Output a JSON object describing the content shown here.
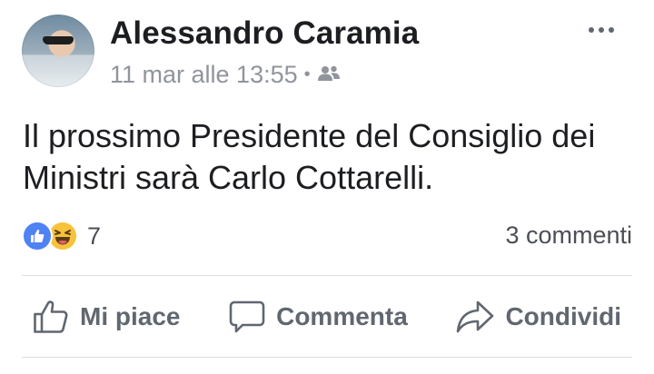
{
  "post": {
    "author": "Alessandro Caramia",
    "timestamp": "11 mar alle 13:55",
    "separator": "•",
    "audience_icon": "friends-icon",
    "text": "Il prossimo Presidente del Consiglio dei\nMinistri sarà Carlo Cottarelli.",
    "more_icon": "more-options-icon"
  },
  "reactions": {
    "icons": [
      "like-reaction-icon",
      "haha-reaction-icon"
    ],
    "count": "7",
    "comments": "3 commenti"
  },
  "actions": {
    "like": "Mi piace",
    "comment": "Commenta",
    "share": "Condividi"
  },
  "colors": {
    "like_blue": "#4f82f3",
    "haha_yellow": "#f7c33d",
    "muted_text": "#90949c",
    "action_text": "#606770"
  }
}
